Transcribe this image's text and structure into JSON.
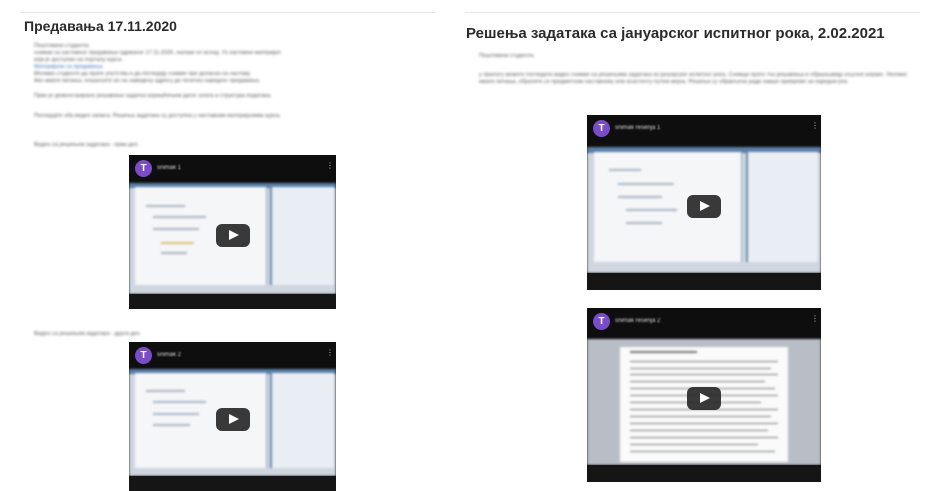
{
  "left_post": {
    "title": "Предавања 17.11.2020",
    "body_lines": [
      "Поштовани студенти,",
      "снимак са наставног предавања одржаног 17.11.2020. налази се испод. Уз наставни материјал",
      "који је доступан на порталу курса.",
      "Материјали за вежбање су доступни на линку.",
      "Молимо студенте да прате упутства и да погледају снимке пре доласка на наставу.",
      "Ако имате питања, пошаљите их на наведену адресу до почетка наредног предавања."
    ],
    "link_text": "Материјали са предавања",
    "para2": "Прво је демонстрирано решавање задатка коришћењем датог алата и структура података.",
    "para3": "Погледајте оба видео записа. Решења задатака су доступна у наставним материјалима курса.",
    "video_label_1": "Видео са решењем задатака - први део",
    "video_label_2": "Видео са решењем задатака - други део",
    "video_1": {
      "avatar_letter": "Т",
      "title": "snimak 1"
    },
    "video_2": {
      "avatar_letter": "Т",
      "title": "snimak 2"
    }
  },
  "right_post": {
    "title": "Решења задатака са јануарског испитног рока, 2.02.2021",
    "intro": "Поштовани студенти,",
    "body": "у прилогу можете погледати видео снимке са решењима задатака из јануарског испитног рока. Снимци прате ток решавања и објашњавају кључне кораке. Уколико имате питања, обратите се предметном наставнику или асистенту путем мејла. Решења су објављена ради лакше припреме за наредни рок.",
    "video_1": {
      "avatar_letter": "Т",
      "title": "snimak resenja 1"
    },
    "video_2": {
      "avatar_letter": "Т",
      "title": "snimak resenja 2"
    }
  }
}
